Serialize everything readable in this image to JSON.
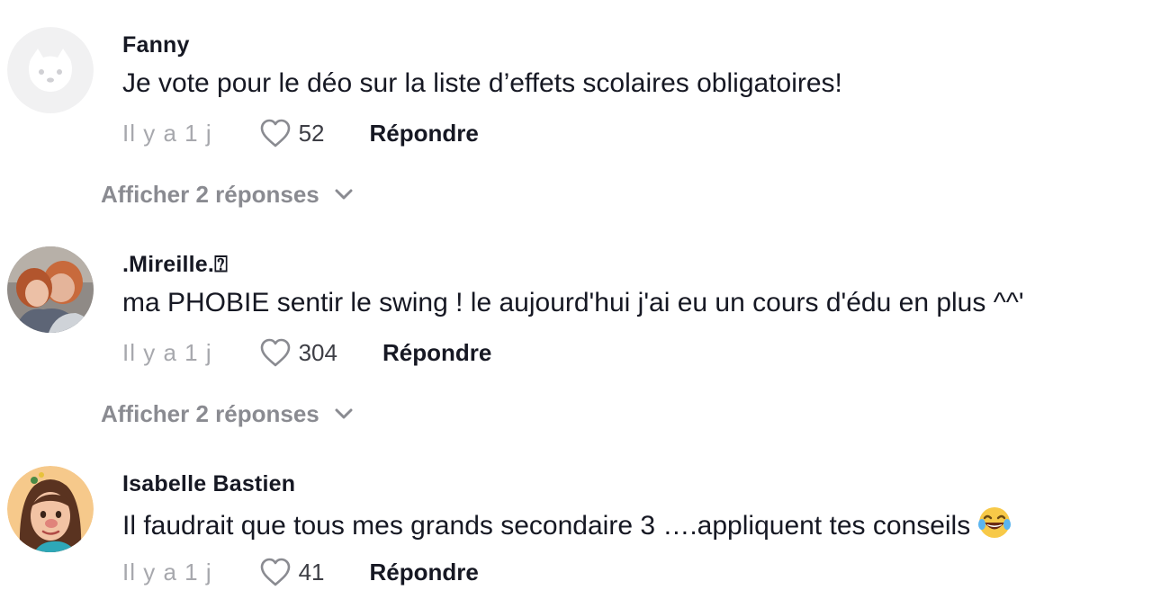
{
  "comments": [
    {
      "username": "Fanny",
      "text": "Je vote pour le déo sur la liste d’effets scolaires obligatoires!",
      "time": "Il y a 1 j",
      "likes": "52",
      "reply_label": "Répondre",
      "show_replies_label": "Afficher 2 réponses"
    },
    {
      "username": ".Mireille.⍰",
      "text": "ma PHOBIE sentir le swing ! le aujourd'hui j'ai eu un cours d'édu en plus ^^'",
      "time": "Il y a 1 j",
      "likes": "304",
      "reply_label": "Répondre",
      "show_replies_label": "Afficher 2 réponses"
    },
    {
      "username": "Isabelle Bastien",
      "text": "Il faudrait que tous mes grands secondaire 3 ….appliquent tes conseils",
      "time": "Il y a 1 j",
      "likes": "41",
      "reply_label": "Répondre"
    }
  ],
  "colors": {
    "text_primary": "#161823",
    "text_secondary": "#8a8b91",
    "background": "#ffffff"
  },
  "icons": {
    "like": "heart-outline-icon",
    "expand": "chevron-down-icon",
    "emoji": "face-with-tears-of-joy-emoji"
  }
}
